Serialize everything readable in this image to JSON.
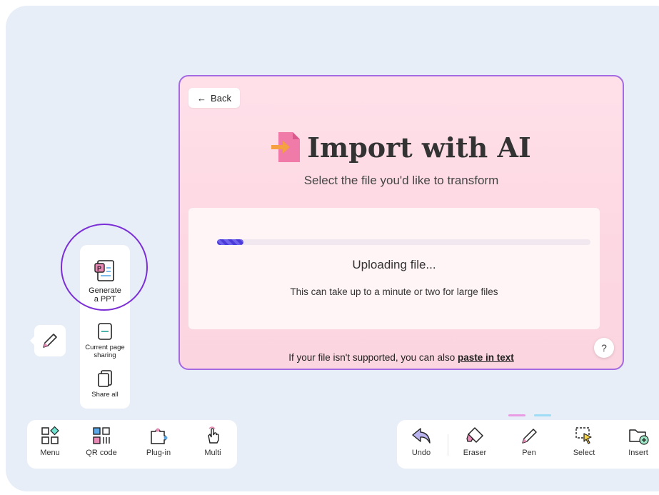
{
  "dialog": {
    "back_label": "Back",
    "title": "Import with AI",
    "subtitle": "Select the file you'd like to transform",
    "progress": 0.07,
    "upload_status": "Uploading file...",
    "upload_hint": "This can take up to a minute or two for large files",
    "footer_text": "If your file isn't supported, you can also ",
    "footer_link": "paste in text",
    "help_label": "?"
  },
  "side_panel": {
    "items": [
      {
        "label": "Generate a PPT"
      },
      {
        "label": "Current page sharing"
      },
      {
        "label": "Share all"
      }
    ]
  },
  "left_toolbar": {
    "items": [
      {
        "label": "Menu",
        "icon": "menu-icon"
      },
      {
        "label": "QR code",
        "icon": "qr-code-icon"
      },
      {
        "label": "Plug-in",
        "icon": "plugin-icon"
      },
      {
        "label": "Multi",
        "icon": "multi-touch-icon"
      }
    ]
  },
  "right_toolbar": {
    "items": [
      {
        "label": "Undo",
        "icon": "undo-icon"
      },
      {
        "label": "Eraser",
        "icon": "eraser-icon"
      },
      {
        "label": "Pen",
        "icon": "pen-icon"
      },
      {
        "label": "Select",
        "icon": "select-icon"
      },
      {
        "label": "Insert",
        "icon": "insert-folder-icon"
      }
    ]
  },
  "colors": {
    "accent": "#7b2ed6",
    "dialog_border": "#a46ae2",
    "progress": "#4b3bd9",
    "canvas": "#e8eef8"
  }
}
